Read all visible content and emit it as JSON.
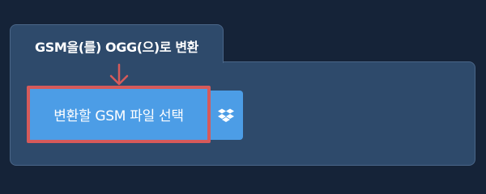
{
  "panel": {
    "title": "GSM을(를) OGG(으)로 변환"
  },
  "upload": {
    "select_label": "변환할 GSM 파일 선택",
    "dropbox_icon": "dropbox-icon"
  },
  "colors": {
    "background": "#152338",
    "panel": "#2e4a6b",
    "button": "#4c9de6",
    "highlight": "#d65a5a"
  }
}
